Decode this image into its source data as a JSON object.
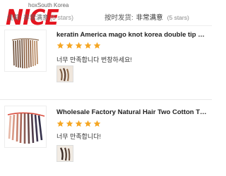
{
  "header": {
    "logo_text": "NICE",
    "origin": "hoxSouth Korea",
    "left_rating": "佳莉: 非常满意",
    "left_stars_count": "(5 stars)",
    "right_rating_label": "按时发货:",
    "right_rating_value": "非常满意",
    "right_stars_count": "(5 stars)"
  },
  "colors": {
    "logo_red": "#e4151f",
    "star_orange": "#f5a623",
    "title_text": "#222222"
  },
  "reviews": [
    {
      "product_title": "keratin America mago knot korea double tip hu...",
      "rating": 5,
      "text": "너무 만족합니다 번창하세요!",
      "thumb_icon": "hair-extension-thumbnail",
      "photo_icon": "review-photo-thumbnail"
    },
    {
      "product_title": "Wholesale Factory Natural Hair Two Cotton Thr...",
      "rating": 5,
      "text": "너무 만족합니다!",
      "thumb_icon": "hair-extension-thumbnail",
      "photo_icon": "review-photo-thumbnail"
    }
  ]
}
